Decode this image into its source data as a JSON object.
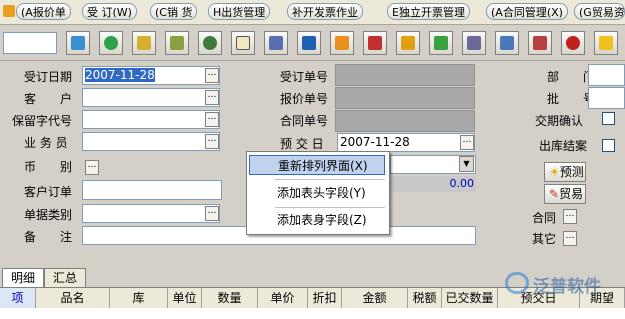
{
  "menu": {
    "tabs": [
      {
        "label": "(A报价单"
      },
      {
        "label": "受 订(W)"
      },
      {
        "label": "(C销 货"
      },
      {
        "label": "H出货管理"
      },
      {
        "label": "补开发票作业"
      },
      {
        "label": "E独立开票管理"
      },
      {
        "label": "(A合同管理(X)"
      },
      {
        "label": "(G贸易资"
      }
    ]
  },
  "toolbar": {
    "icons": [
      "new-icon",
      "refresh-icon",
      "find-icon",
      "check-icon",
      "globe-icon",
      "card-icon",
      "book-icon",
      "monitor-icon",
      "export-icon",
      "print-icon",
      "money-icon",
      "recycle-icon",
      "calc-icon",
      "copy-icon",
      "list-icon",
      "bug-icon",
      "bell-icon",
      "exit-icon"
    ]
  },
  "form": {
    "order_date_label": "受订日期",
    "order_date": "2007-11-28",
    "customer_label": "客　　户",
    "reserve_label": "保留字代号",
    "salesman_label": "业 务 员",
    "currency_label": "币　　别",
    "cust_order_label": "客户订单",
    "doc_type_label": "单据类别",
    "remark_label": "备　　注",
    "order_no_label": "受订单号",
    "quote_no_label": "报价单号",
    "contract_no_label": "合同单号",
    "delivery_label": "预 交 日",
    "delivery_date": "2007-11-28",
    "amount": "0.00",
    "dept_label": "部　　门",
    "batch_label": "批　　号",
    "deal_confirm_label": "交期确认",
    "closed_label": "出库结案",
    "forecast_label": "预测",
    "trade_label": "贸易",
    "contract_label": "合同",
    "other_label": "其它"
  },
  "context_menu": {
    "items": [
      {
        "label": "重新排列界面(X)"
      },
      {
        "label": "添加表头字段(Y)"
      },
      {
        "label": "添加表身字段(Z)"
      }
    ]
  },
  "bottom_tabs": [
    {
      "label": "明细"
    },
    {
      "label": "汇总"
    }
  ],
  "grid": {
    "columns": [
      "项",
      "品名",
      "库",
      "单位",
      "数量",
      "单价",
      "折扣",
      "金额",
      "税额",
      "已交数量",
      "预交日",
      "期望"
    ]
  },
  "watermark": "泛普软件",
  "colors": {
    "accent": "#316ac5",
    "gray_field": "#a9a9a9",
    "amount_blue": "#0000c0"
  }
}
